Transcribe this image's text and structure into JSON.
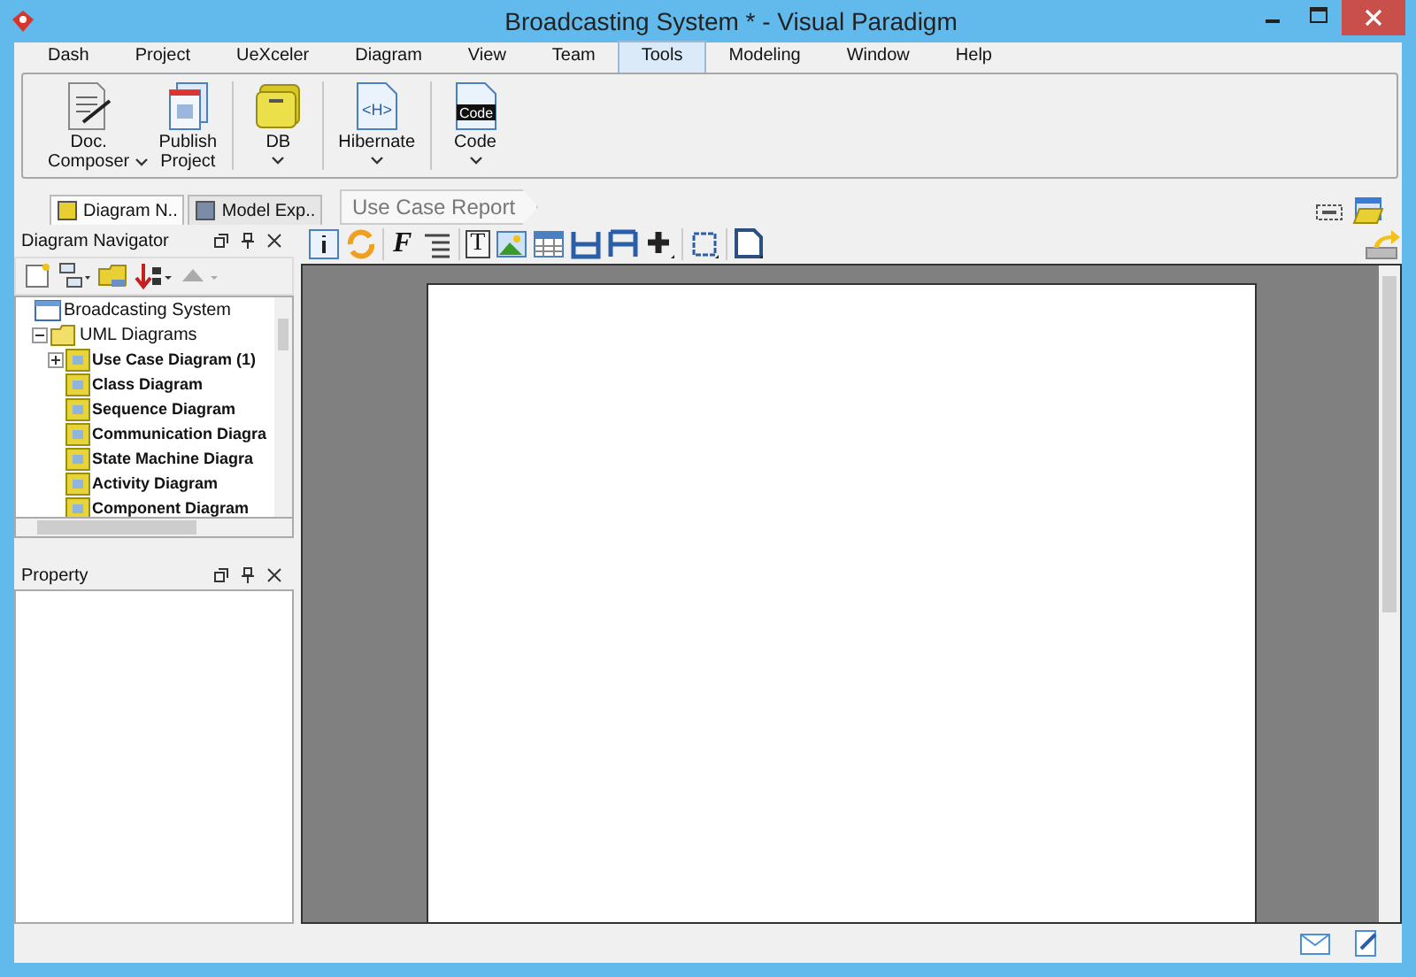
{
  "window": {
    "title": "Broadcasting System * - Visual Paradigm"
  },
  "menu_tabs": [
    {
      "label": "Dash",
      "selected": false
    },
    {
      "label": "Project",
      "selected": false
    },
    {
      "label": "UeXceler",
      "selected": false
    },
    {
      "label": "Diagram",
      "selected": false
    },
    {
      "label": "View",
      "selected": false
    },
    {
      "label": "Team",
      "selected": false
    },
    {
      "label": "Tools",
      "selected": true
    },
    {
      "label": "Modeling",
      "selected": false
    },
    {
      "label": "Window",
      "selected": false
    },
    {
      "label": "Help",
      "selected": false
    }
  ],
  "ribbon": [
    {
      "kind": "document",
      "label_lines": [
        "Doc.",
        "Composer"
      ],
      "dropdown": true
    },
    {
      "kind": "publish",
      "label_lines": [
        "Publish",
        "Project"
      ],
      "dropdown": false
    },
    {
      "kind": "database",
      "label_lines": [
        "DB"
      ],
      "dropdown": true
    },
    {
      "kind": "hibernate",
      "label_lines": [
        "Hibernate"
      ],
      "dropdown": true,
      "icon_text": "<H>"
    },
    {
      "kind": "code",
      "label_lines": [
        "Code"
      ],
      "dropdown": true,
      "icon_text": "Code"
    }
  ],
  "panel_tabs": [
    {
      "label": "Diagram N..",
      "selected": true
    },
    {
      "label": "Model Exp..",
      "selected": false
    }
  ],
  "breadcrumb": "Use Case Report",
  "toolbar": {
    "font_glyph": "F",
    "text_glyph": "T"
  },
  "diagram_navigator": {
    "title": "Diagram Navigator",
    "tree": [
      {
        "label": "Broadcasting System",
        "kind": "project",
        "children": [
          {
            "label": "UML Diagrams",
            "kind": "folder",
            "expanded": true,
            "children": [
              {
                "label": "Use Case Diagram (1)",
                "kind": "diagram",
                "expanded": false
              },
              {
                "label": "Class Diagram",
                "kind": "diagram"
              },
              {
                "label": "Sequence Diagram",
                "kind": "diagram"
              },
              {
                "label": "Communication Diagra",
                "kind": "diagram"
              },
              {
                "label": "State Machine Diagra",
                "kind": "diagram"
              },
              {
                "label": "Activity Diagram",
                "kind": "diagram"
              },
              {
                "label": "Component Diagram",
                "kind": "diagram"
              }
            ]
          }
        ]
      }
    ]
  },
  "property_panel": {
    "title": "Property"
  }
}
